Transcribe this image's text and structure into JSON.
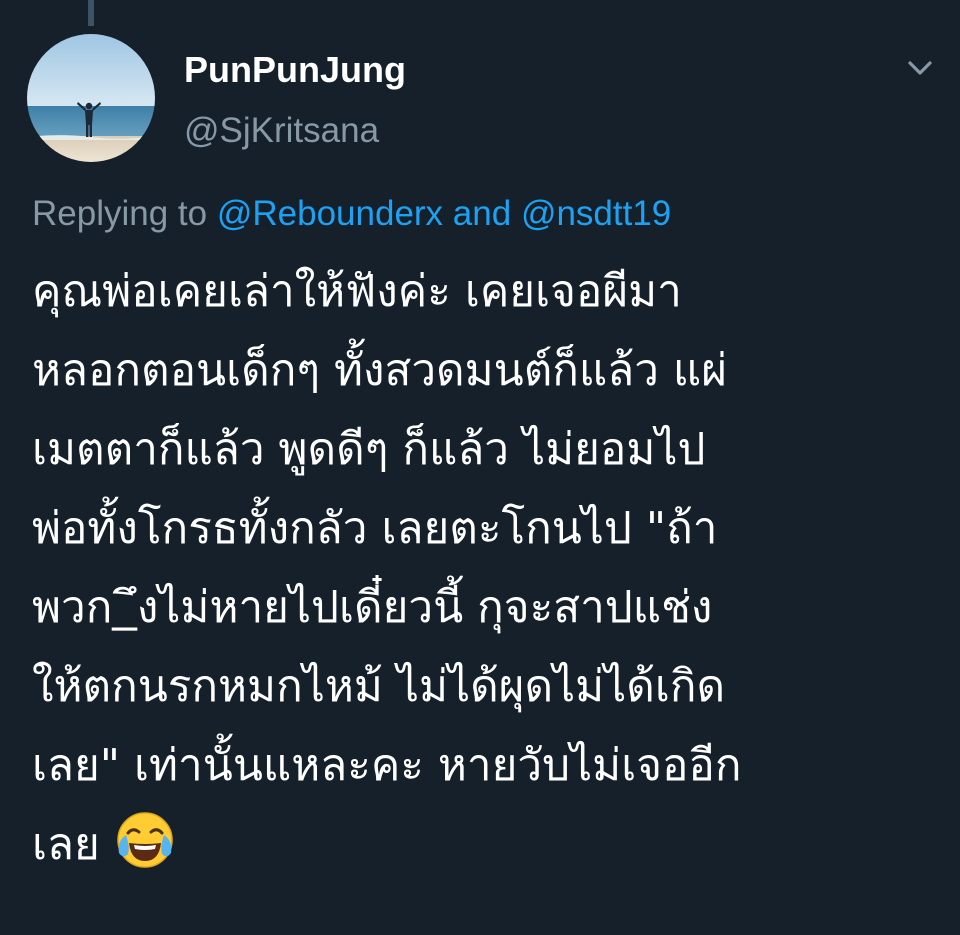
{
  "tweet": {
    "author": {
      "display_name": "PunPunJung",
      "handle": "@SjKritsana",
      "avatar": "avatar-beach-photo"
    },
    "menu_icon": "chevron-down-icon",
    "reply": {
      "prefix": "Replying to",
      "mention_1": "@Rebounderx",
      "joiner": "and",
      "mention_2": "@nsdtt19"
    },
    "body_lines": [
      "คุณพ่อเคยเล่าให้ฟังค่ะ เคยเจอผีมา",
      "หลอกตอนเด็กๆ ทั้งสวดมนต์ก็แล้ว แผ่",
      "เมตตาก็แล้ว พูดดีๆ ก็แล้ว ไม่ยอมไป",
      "พ่อทั้งโกรธทั้งกลัว เลยตะโกนไป \"ถ้า",
      "พวก_ึงไม่หายไปเดี๋ยวนี้ กุจะสาปแช่ง",
      "ให้ตกนรกหมกไหม้ ไม่ได้ผุดไม่ได้เกิด",
      "เลย\" เท่านั้นแหละคะ หายวับไม่เจออีก",
      "เลย"
    ],
    "emoji": "face-with-tears-of-joy-icon"
  },
  "colors": {
    "background": "#15202b",
    "text": "#ffffff",
    "secondary": "#8899a6",
    "link": "#1da1f2"
  }
}
